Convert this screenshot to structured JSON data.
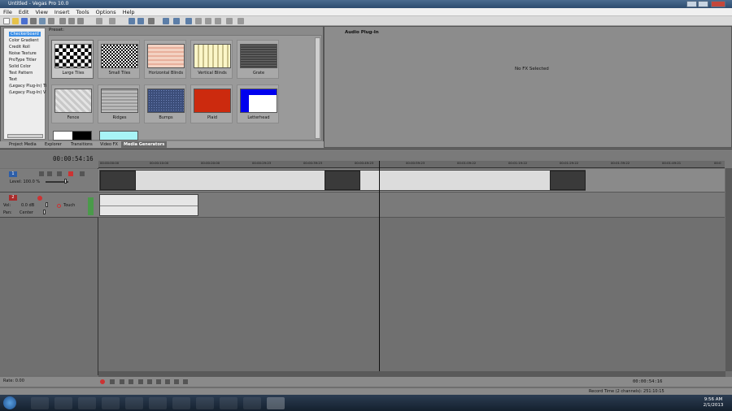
{
  "window": {
    "title": "Untitled - Vegas Pro 10.0"
  },
  "menu": [
    "File",
    "Edit",
    "View",
    "Insert",
    "Tools",
    "Options",
    "Help"
  ],
  "generators": {
    "items": [
      "Checkerboard",
      "Color Gradient",
      "Credit Roll",
      "Noise Texture",
      "ProType Titler",
      "Solid Color",
      "Test Pattern",
      "Text",
      "(Legacy Plug-In) Ti",
      "(Legacy Plug-In) V"
    ],
    "preset_label": "Preset:",
    "presets": [
      "Large Tiles",
      "Small Tiles",
      "Horizontal Blinds",
      "Vertical Blinds",
      "Grate",
      "Fence",
      "Ridges",
      "Bumps",
      "Plaid",
      "Letterhead"
    ]
  },
  "tabs": [
    "Project Media",
    "Explorer",
    "Transitions",
    "Video FX",
    "Media Generators"
  ],
  "fx_panel": {
    "title": "Audio Plug-In",
    "empty_text": "No FX Selected"
  },
  "timeline": {
    "timecode": "00:00:54:16",
    "ruler": [
      "00:00:00:00",
      "00:00:10:00",
      "00:00:20:00",
      "00:00:29:23",
      "00:00:39:23",
      "00:00:49:23",
      "00:00:59:23",
      "00:01:09:22",
      "00:01:19:22",
      "00:01:29:22",
      "00:01:39:22",
      "00:01:49:21",
      "00:0"
    ],
    "video_track": {
      "number": "1",
      "level_label": "Level: 100.0 %"
    },
    "audio_track": {
      "number": "2",
      "vol_label": "Vol:",
      "vol_value": "0.0 dB",
      "pan_label": "Pan:",
      "pan_value": "Center",
      "mode": "Touch"
    }
  },
  "transport": {
    "rate": "Rate: 0.00",
    "timecode": "00:00:54:16"
  },
  "status": {
    "record_time": "Record Time (2 channels): 251:10:15"
  },
  "taskbar": {
    "time": "9:56 AM",
    "date": "2/1/2013"
  }
}
